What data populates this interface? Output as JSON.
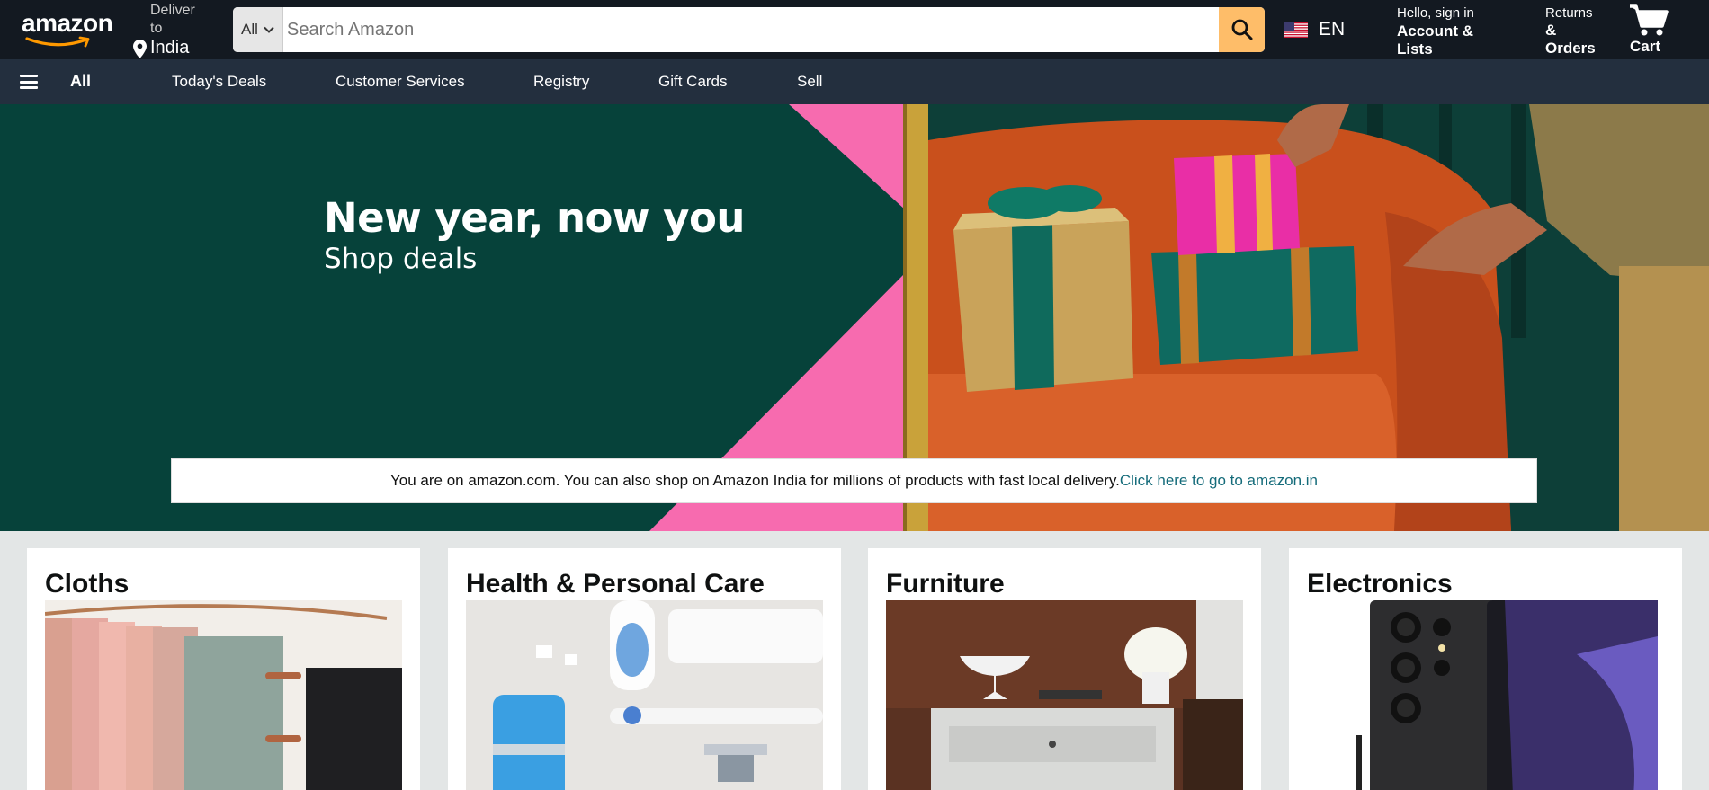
{
  "header": {
    "logo_text": "amazon",
    "deliver_label": "Deliver to",
    "deliver_location": "India",
    "search": {
      "category": "All",
      "placeholder": "Search Amazon"
    },
    "language": "EN",
    "account_greeting": "Hello, sign in",
    "account_label": "Account & Lists",
    "returns_label": "Returns",
    "orders_label": "& Orders",
    "cart_label": "Cart"
  },
  "subnav": {
    "all_label": "All",
    "links": [
      "Today's Deals",
      "Customer Services",
      "Registry",
      "Gift Cards",
      "Sell"
    ]
  },
  "hero": {
    "title": "New year, now you",
    "subtitle": "Shop deals",
    "notice_text": "You are on amazon.com. You can also shop on Amazon India for millions of products with fast local delivery.",
    "notice_link": "Click here to go to amazon.in"
  },
  "categories": [
    {
      "title": "Cloths"
    },
    {
      "title": "Health & Personal Care"
    },
    {
      "title": "Furniture"
    },
    {
      "title": "Electronics"
    }
  ],
  "colors": {
    "nav_dark": "#131921",
    "nav_sub": "#232f3e",
    "search_button": "#febd69",
    "hero_green": "#06423a",
    "hero_pink": "#f76baf",
    "link_teal": "#146b7a"
  }
}
